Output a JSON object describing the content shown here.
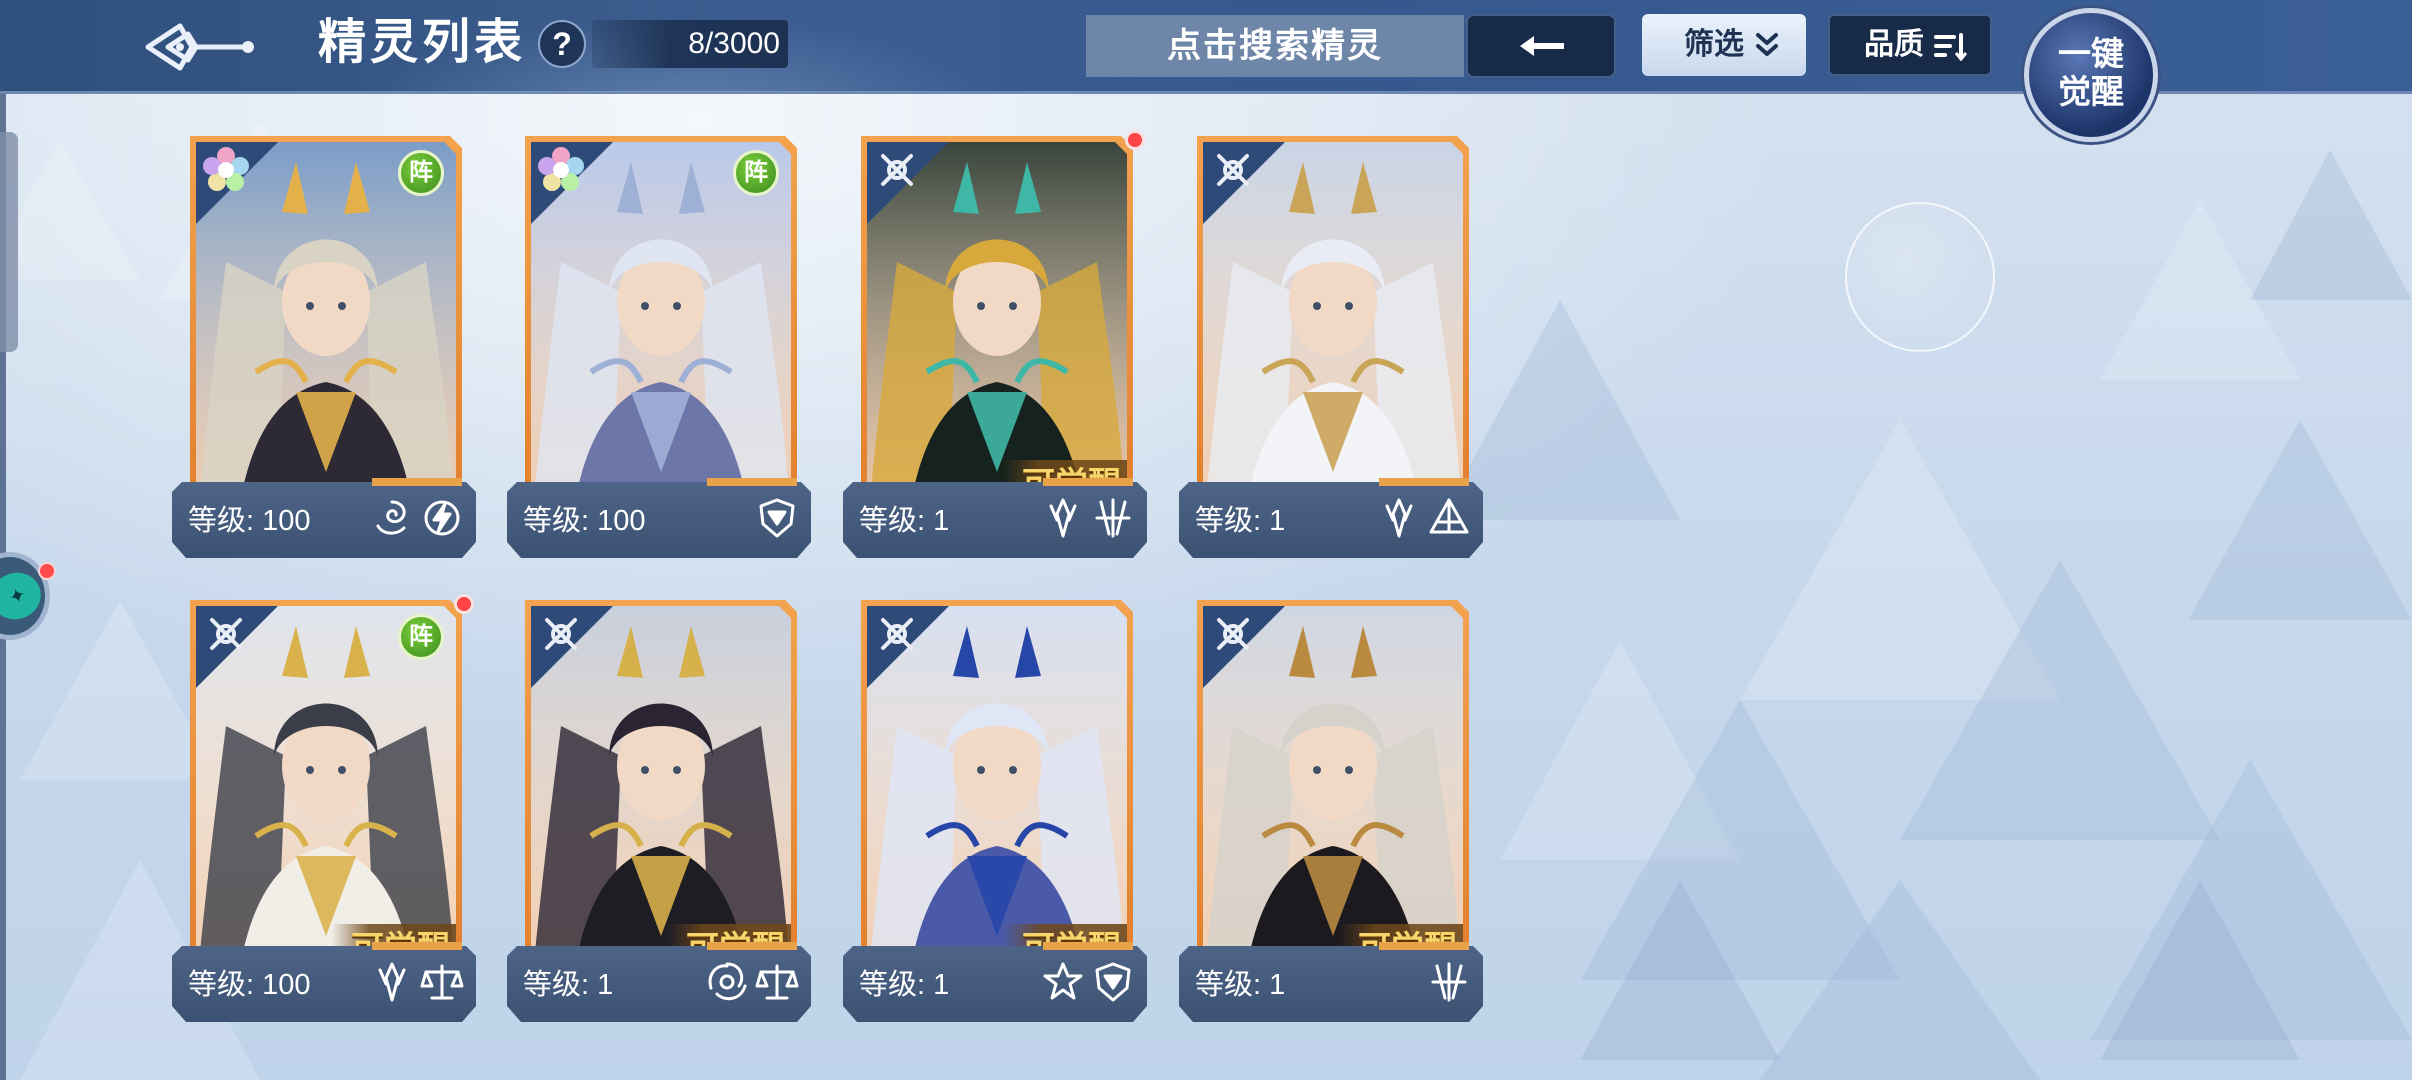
{
  "header": {
    "title": "精灵列表",
    "help_label": "?",
    "count": "8/3000",
    "search_placeholder": "点击搜索精灵",
    "filter_label": "筛选",
    "quality_label": "品质",
    "awaken_line1": "一键",
    "awaken_line2": "觉醒"
  },
  "colors": {
    "header_bg": "#35588d",
    "card_frame": "#e88a34",
    "awaken_text": "#f7d56b",
    "team_badge": "#5aa52a",
    "red_dot": "#ff4545"
  },
  "cards": [
    {
      "level_label": "等级: 100",
      "team": "阵",
      "awaken": "",
      "corner_icon": "flower-icon",
      "elements": [
        "swirl-element-icon",
        "lightning-element-icon"
      ],
      "red_dot": false,
      "lock_badge": true,
      "art": {
        "bg": "#7a9cc7",
        "hair": "#d8d3c4",
        "accent": "#e3b04a",
        "cloth": "#2d2a36"
      }
    },
    {
      "level_label": "等级: 100",
      "team": "阵",
      "awaken": "",
      "corner_icon": "flower-icon",
      "elements": [
        "shield-element-icon"
      ],
      "red_dot": false,
      "lock_badge": false,
      "art": {
        "bg": "#b9c9ea",
        "hair": "#dfe6f2",
        "accent": "#9fb0d6",
        "cloth": "#6d76a8"
      }
    },
    {
      "level_label": "等级: 1",
      "team": "",
      "awaken": "可觉醒",
      "corner_icon": "cross-icon",
      "elements": [
        "blade-element-icon",
        "claw-element-icon"
      ],
      "red_dot": true,
      "lock_badge": false,
      "art": {
        "bg": "#38443b",
        "hair": "#d7a93c",
        "accent": "#3fb7a6",
        "cloth": "#16221d"
      }
    },
    {
      "level_label": "等级: 1",
      "team": "",
      "awaken": "",
      "corner_icon": "cross-icon",
      "elements": [
        "blade-element-icon",
        "pyramid-element-icon"
      ],
      "red_dot": false,
      "lock_badge": false,
      "art": {
        "bg": "#c9d4e6",
        "hair": "#e9ecf4",
        "accent": "#caa457",
        "cloth": "#f3f4f8"
      }
    },
    {
      "level_label": "等级: 100",
      "team": "阵",
      "awaken": "可觉醒",
      "corner_icon": "cross-icon",
      "elements": [
        "blade-element-icon",
        "scale-element-icon"
      ],
      "red_dot": true,
      "lock_badge": false,
      "art": {
        "bg": "#dfe4ec",
        "hair": "#3b3e48",
        "accent": "#d9b24c",
        "cloth": "#f0eee6"
      }
    },
    {
      "level_label": "等级: 1",
      "team": "",
      "awaken": "可觉醒",
      "corner_icon": "cross-icon",
      "elements": [
        "vortex-element-icon",
        "scale-element-icon"
      ],
      "red_dot": false,
      "lock_badge": false,
      "art": {
        "bg": "#c8cfdc",
        "hair": "#2a2433",
        "accent": "#d6b04a",
        "cloth": "#1f1d24"
      }
    },
    {
      "level_label": "等级: 1",
      "team": "",
      "awaken": "可觉醒",
      "corner_icon": "cross-icon",
      "elements": [
        "star-element-icon",
        "shield-element-icon"
      ],
      "red_dot": false,
      "lock_badge": false,
      "art": {
        "bg": "#d7dff0",
        "hair": "#dfe6f6",
        "accent": "#2646a8",
        "cloth": "#4a5aa8"
      }
    },
    {
      "level_label": "等级: 1",
      "team": "",
      "awaken": "可觉醒",
      "corner_icon": "cross-icon",
      "elements": [
        "claw-element-icon"
      ],
      "red_dot": false,
      "lock_badge": false,
      "art": {
        "bg": "#cfd6e2",
        "hair": "#d5d2cc",
        "accent": "#b98a3f",
        "cloth": "#1c1a1f"
      }
    }
  ]
}
